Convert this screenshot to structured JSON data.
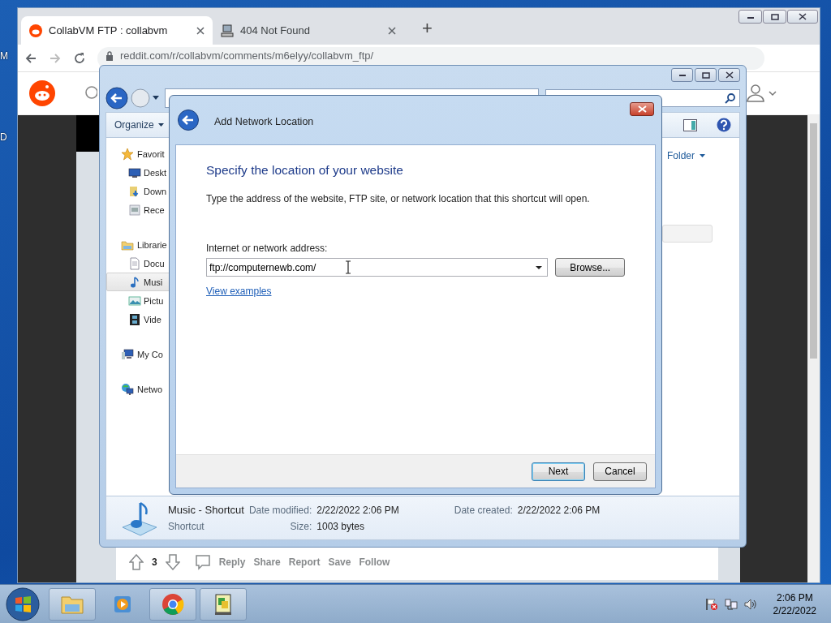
{
  "desktop_icons": [
    {
      "label": "M"
    },
    {
      "label": "D"
    }
  ],
  "browser": {
    "tabs": [
      {
        "title": "CollabVM FTP : collabvm",
        "selected": true
      },
      {
        "title": "404 Not Found",
        "selected": false
      }
    ],
    "new_tab": "+",
    "address": "reddit.com/r/collabvm/comments/m6elyy/collabvm_ftp/",
    "post_actions": {
      "votes": "3",
      "buttons": [
        "Reply",
        "Share",
        "Report",
        "Save",
        "Follow"
      ]
    }
  },
  "explorer": {
    "toolbar": {
      "organize": "Organize"
    },
    "nav_pane": [
      {
        "label": "Favorit",
        "kind": "star",
        "selected": false,
        "children": [
          {
            "label": "Deskt",
            "kind": "desktop",
            "selected": false
          },
          {
            "label": "Down",
            "kind": "downloads",
            "selected": false
          },
          {
            "label": "Rece",
            "kind": "recent",
            "selected": false
          }
        ]
      },
      {
        "label": "Librarie",
        "kind": "library",
        "selected": false,
        "children": [
          {
            "label": "Docu",
            "kind": "document",
            "selected": false
          },
          {
            "label": "Musi",
            "kind": "music",
            "selected": true
          },
          {
            "label": "Pictu",
            "kind": "picture",
            "selected": false
          },
          {
            "label": "Vide",
            "kind": "video",
            "selected": false
          }
        ]
      },
      {
        "label": "My Co",
        "kind": "computer",
        "selected": false
      },
      {
        "label": "Netwo",
        "kind": "network",
        "selected": false
      }
    ],
    "arrange": "Folder",
    "details": {
      "name": "Music - Shortcut",
      "type": "Shortcut",
      "fields": [
        {
          "label": "Date modified:",
          "value": "2/22/2022 2:06 PM"
        },
        {
          "label": "Size:",
          "value": "1003 bytes"
        },
        {
          "label": "Date created:",
          "value": "2/22/2022 2:06 PM"
        }
      ]
    }
  },
  "dialog": {
    "title": "Add Network Location",
    "heading": "Specify the location of your website",
    "description": "Type the address of the website, FTP site, or network location that this shortcut will open.",
    "address_label": "Internet or network address:",
    "address_value": "ftp://computernewb.com/",
    "browse": "Browse...",
    "link": "View examples",
    "buttons": [
      "Next",
      "Cancel"
    ]
  },
  "taskbar": {
    "time": "2:06 PM",
    "date": "2/22/2022"
  }
}
